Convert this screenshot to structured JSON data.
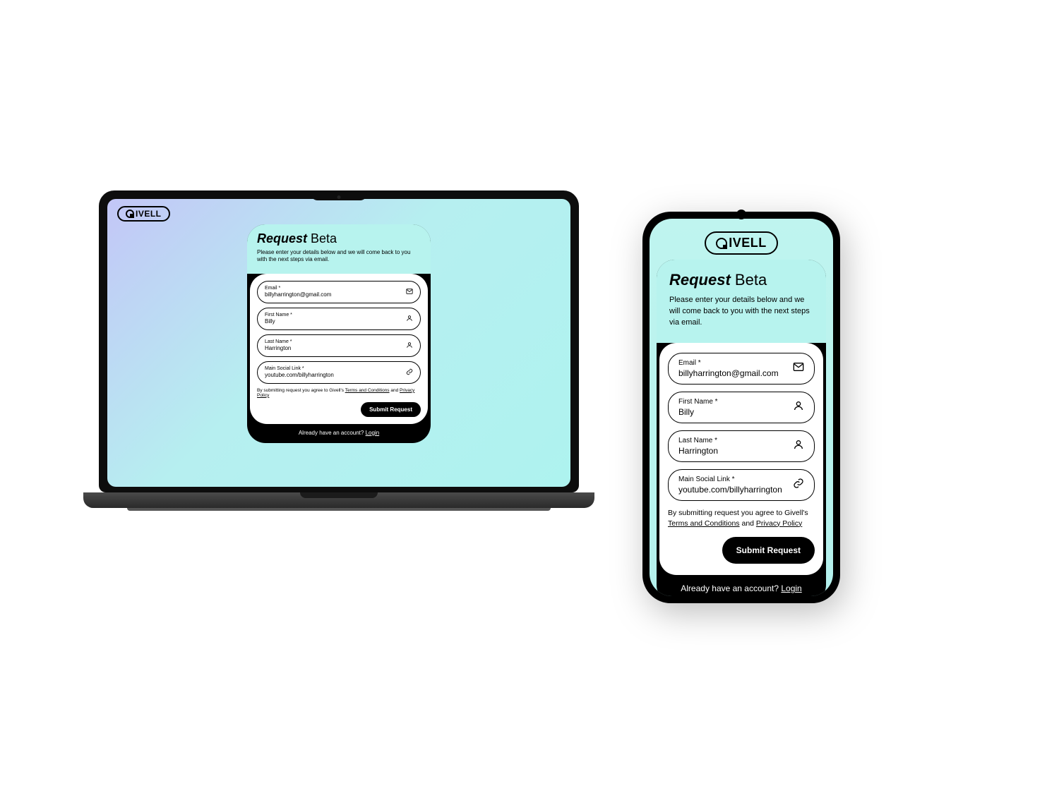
{
  "brand": "IVELL",
  "card": {
    "title_em": "Request",
    "title_rest": "Beta",
    "subtitle": "Please enter your details below and we will come back to you with the next steps via email."
  },
  "fields": {
    "email": {
      "label": "Email *",
      "value": "billyharrington@gmail.com"
    },
    "first_name": {
      "label": "First Name *",
      "value": "Billy"
    },
    "last_name": {
      "label": "Last Name *",
      "value": "Harrington"
    },
    "social": {
      "label": "Main Social Link *",
      "value": "youtube.com/billyharrington"
    }
  },
  "consent": {
    "pre": "By submitting request you agree to Givell's ",
    "terms": "Terms and Conditions",
    "mid": " and ",
    "privacy": "Privacy Policy"
  },
  "submit_label": "Submit Request",
  "footer": {
    "text": "Already have an account? ",
    "login": "Login"
  }
}
